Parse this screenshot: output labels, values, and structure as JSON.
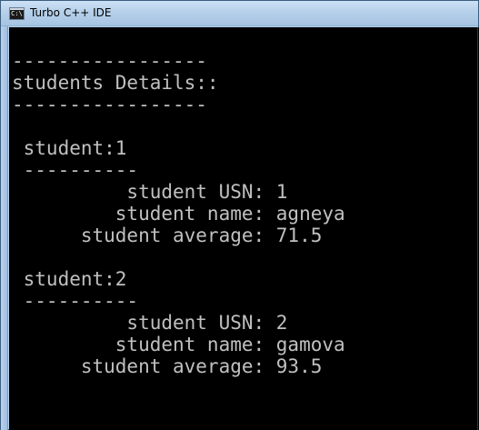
{
  "window": {
    "title": "Turbo C++ IDE",
    "icon": "console-app-icon",
    "icon_glyph": "C:\\"
  },
  "console": {
    "lines": [
      "-----------------",
      "students Details::",
      "-----------------",
      " student:1",
      " ----------",
      "          student USN: 1",
      "         student name: agneya",
      "      student average: 71.5",
      " student:2",
      " ----------",
      "          student USN: 2",
      "         student name: gamova",
      "      student average: 93.5"
    ]
  },
  "colors": {
    "console_background": "#000000",
    "console_text": "#c0c0c0",
    "titlebar": "#b6d0ea"
  }
}
